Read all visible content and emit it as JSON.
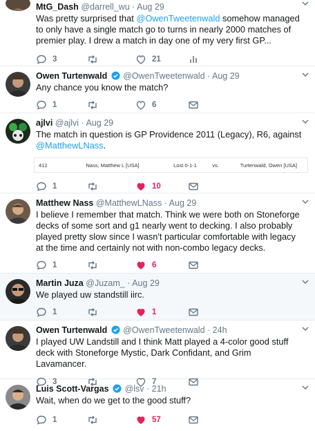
{
  "tweets": [
    {
      "name": "MtG_Dash",
      "handle": "@darrell_wu",
      "dot": "·",
      "time": "Aug 29",
      "verified": false,
      "text_parts": [
        "Was pretty surprised that ",
        "@OwenTweetenwald",
        " somehow managed to only have a single match go to turns in nearly 2000 matches of premier play. I drew a match in day one of my very first GP..."
      ],
      "reply_count": "3",
      "retweet_count": "",
      "like_count": "21",
      "liked": false,
      "last_action": "analytics-icon"
    },
    {
      "name": "Owen Turtenwald",
      "handle": "@OwenTweetenwald",
      "dot": "·",
      "time": "Aug 29",
      "verified": true,
      "text": "Any chance you know the match?",
      "reply_count": "1",
      "retweet_count": "",
      "like_count": "6",
      "liked": false,
      "last_action": "mail-icon"
    },
    {
      "name": "ajlvi",
      "handle": "@ajlvi",
      "dot": "·",
      "time": "Aug 29",
      "verified": false,
      "text_parts": [
        "The match in question is GP Providence 2011 (Legacy), R6, against ",
        "@MatthewLNass",
        "."
      ],
      "match": {
        "table": "412",
        "player1": "Nass, Matthew L [USA]",
        "result": "Lost 0-1-1",
        "vs": "vs.",
        "player2": "Turtenwald, Owen [USA]"
      },
      "reply_count": "1",
      "retweet_count": "",
      "like_count": "10",
      "liked": true,
      "last_action": "mail-icon"
    },
    {
      "name": "Matthew Nass",
      "handle": "@MatthewLNass",
      "dot": "·",
      "time": "Aug 29",
      "verified": false,
      "text": "I believe I remember that match. Think we were both on Stoneforge decks of some sort and g1 nearly went to decking. I also probably played pretty slow since I wasn't particular comfortable with legacy at the time and certainly not with non-combo legacy decks.",
      "reply_count": "1",
      "retweet_count": "",
      "like_count": "6",
      "liked": true,
      "last_action": "mail-icon"
    },
    {
      "name": "Martin Juza",
      "handle": "@Juzam_",
      "dot": "·",
      "time": "Aug 29",
      "verified": false,
      "text": "We played uw standstill iirc.",
      "reply_count": "1",
      "retweet_count": "",
      "like_count": "1",
      "liked": true,
      "last_action": "mail-icon"
    },
    {
      "name": "Owen Turtenwald",
      "handle": "@OwenTweetenwald",
      "dot": "·",
      "time": "24h",
      "verified": true,
      "text": "I played UW Landstill and I think Matt played a 4-color good stuff deck with Stoneforge Mystic, Dark Confidant, and Grim Lavamancer.",
      "reply_count": "3",
      "retweet_count": "",
      "like_count": "7",
      "liked": false,
      "last_action": "mail-icon"
    },
    {
      "name": "Luis Scott-Vargas",
      "handle": "@lsv",
      "dot": "·",
      "time": "21h",
      "verified": true,
      "text": "Wait, when do we get to the good stuff?",
      "reply_count": "1",
      "retweet_count": "",
      "like_count": "57",
      "liked": true,
      "last_action": "mail-icon"
    }
  ],
  "colors": {
    "mention": "#1da1f2",
    "like_active": "#e0245e",
    "muted": "#657786",
    "verified": "#1da1f2"
  }
}
